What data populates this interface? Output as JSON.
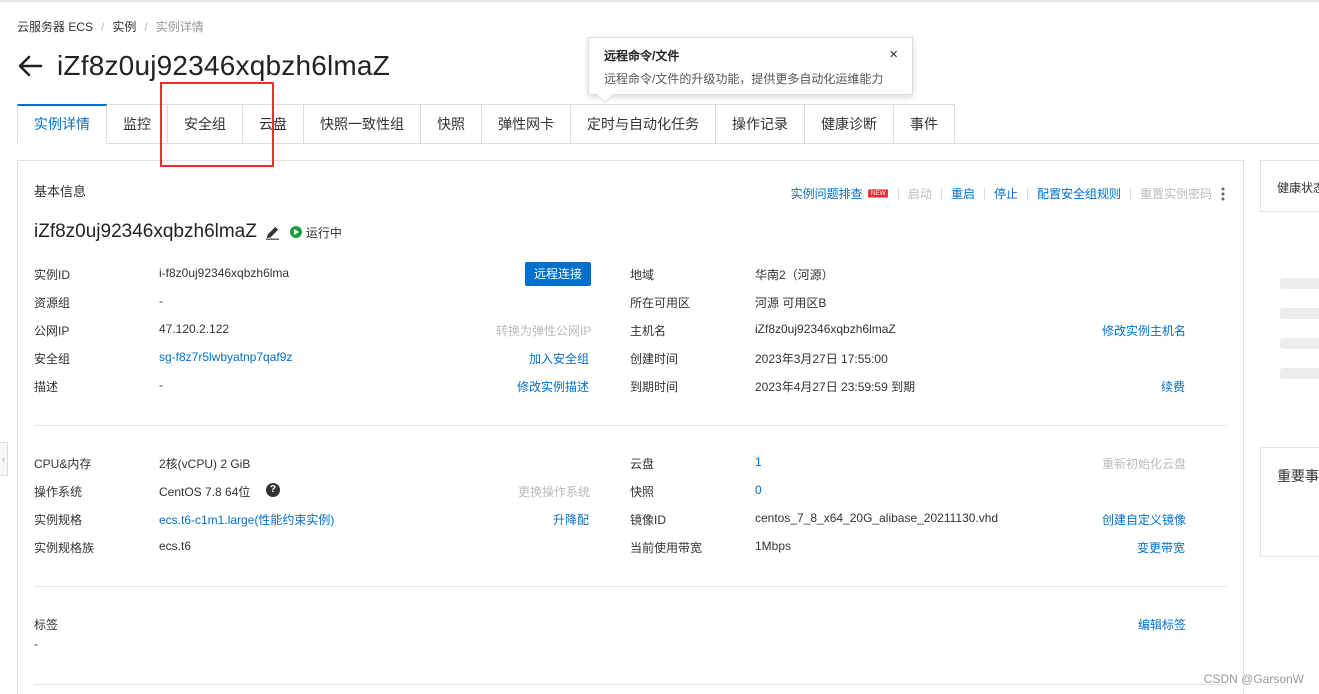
{
  "breadcrumb": {
    "items": [
      "云服务器 ECS",
      "实例",
      "实例详情"
    ]
  },
  "header": {
    "title": "iZf8z0uj92346xqbzh6lmaZ"
  },
  "tooltip": {
    "title": "远程命令/文件",
    "description": "远程命令/文件的升级功能，提供更多自动化运维能力",
    "close": "×"
  },
  "tabs": [
    {
      "label": "实例详情",
      "active": true
    },
    {
      "label": "监控"
    },
    {
      "label": "安全组"
    },
    {
      "label": "云盘"
    },
    {
      "label": "快照一致性组"
    },
    {
      "label": "快照"
    },
    {
      "label": "弹性网卡"
    },
    {
      "label": "定时与自动化任务"
    },
    {
      "label": "操作记录"
    },
    {
      "label": "健康诊断"
    },
    {
      "label": "事件"
    }
  ],
  "panel": {
    "title": "基本信息",
    "actions": {
      "troubleshoot": "实例问题排查",
      "new_badge": "NEW",
      "start": "启动",
      "restart": "重启",
      "stop": "停止",
      "config_sg_rules": "配置安全组规则",
      "reset_password": "重置实例密码"
    },
    "instance_name": "iZf8z0uj92346xqbzh6lmaZ",
    "status": "运行中",
    "remote_connect": "远程连接",
    "left": {
      "instance_id_label": "实例ID",
      "instance_id": "i-f8z0uj92346xqbzh6lma",
      "resource_group_label": "资源组",
      "resource_group": "-",
      "public_ip_label": "公网IP",
      "public_ip": "47.120.2.122",
      "convert_eip": "转换为弹性公网IP",
      "security_group_label": "安全组",
      "security_group": "sg-f8z7r5lwbyatnp7qaf9z",
      "join_sg": "加入安全组",
      "description_label": "描述",
      "description": "-",
      "edit_description": "修改实例描述"
    },
    "right": {
      "region_label": "地域",
      "region": "华南2（河源）",
      "zone_label": "所在可用区",
      "zone": "河源 可用区B",
      "hostname_label": "主机名",
      "hostname": "iZf8z0uj92346xqbzh6lmaZ",
      "edit_hostname": "修改实例主机名",
      "created_label": "创建时间",
      "created": "2023年3月27日 17:55:00",
      "expire_label": "到期时间",
      "expire": "2023年4月27日 23:59:59 到期",
      "renew": "续费"
    },
    "config": {
      "cpu_mem_label": "CPU&内存",
      "cpu_mem": "2核(vCPU) 2 GiB",
      "os_label": "操作系统",
      "os": "CentOS 7.8 64位",
      "os_help": "?",
      "change_os": "更换操作系统",
      "spec_label": "实例规格",
      "spec": "ecs.t6-c1m1.large(性能约束实例)",
      "resize": "升降配",
      "family_label": "实例规格族",
      "family": "ecs.t6",
      "disk_label": "云盘",
      "disk": "1",
      "reinit_disk": "重新初始化云盘",
      "snapshot_label": "快照",
      "snapshot": "0",
      "image_label": "镜像ID",
      "image": "centos_7_8_x64_20G_alibase_20211130.vhd",
      "create_image": "创建自定义镜像",
      "bandwidth_label": "当前使用带宽",
      "bandwidth": "1Mbps",
      "change_bandwidth": "变更带宽"
    },
    "tags": {
      "label": "标签",
      "value": "-",
      "edit": "编辑标签"
    }
  },
  "side": {
    "health_title": "健康状态",
    "events_title": "重要事件"
  },
  "collapse_glyph": "‹",
  "watermark": "CSDN @GarsonW",
  "colors": {
    "accent": "#0070cc",
    "running": "#1e9e3a",
    "highlight": "#e8302f",
    "new_badge": "#e8302f"
  },
  "icons": [
    "arrow-left-icon",
    "close-icon",
    "pencil-icon",
    "play-icon",
    "more-vertical-icon",
    "question-icon"
  ]
}
